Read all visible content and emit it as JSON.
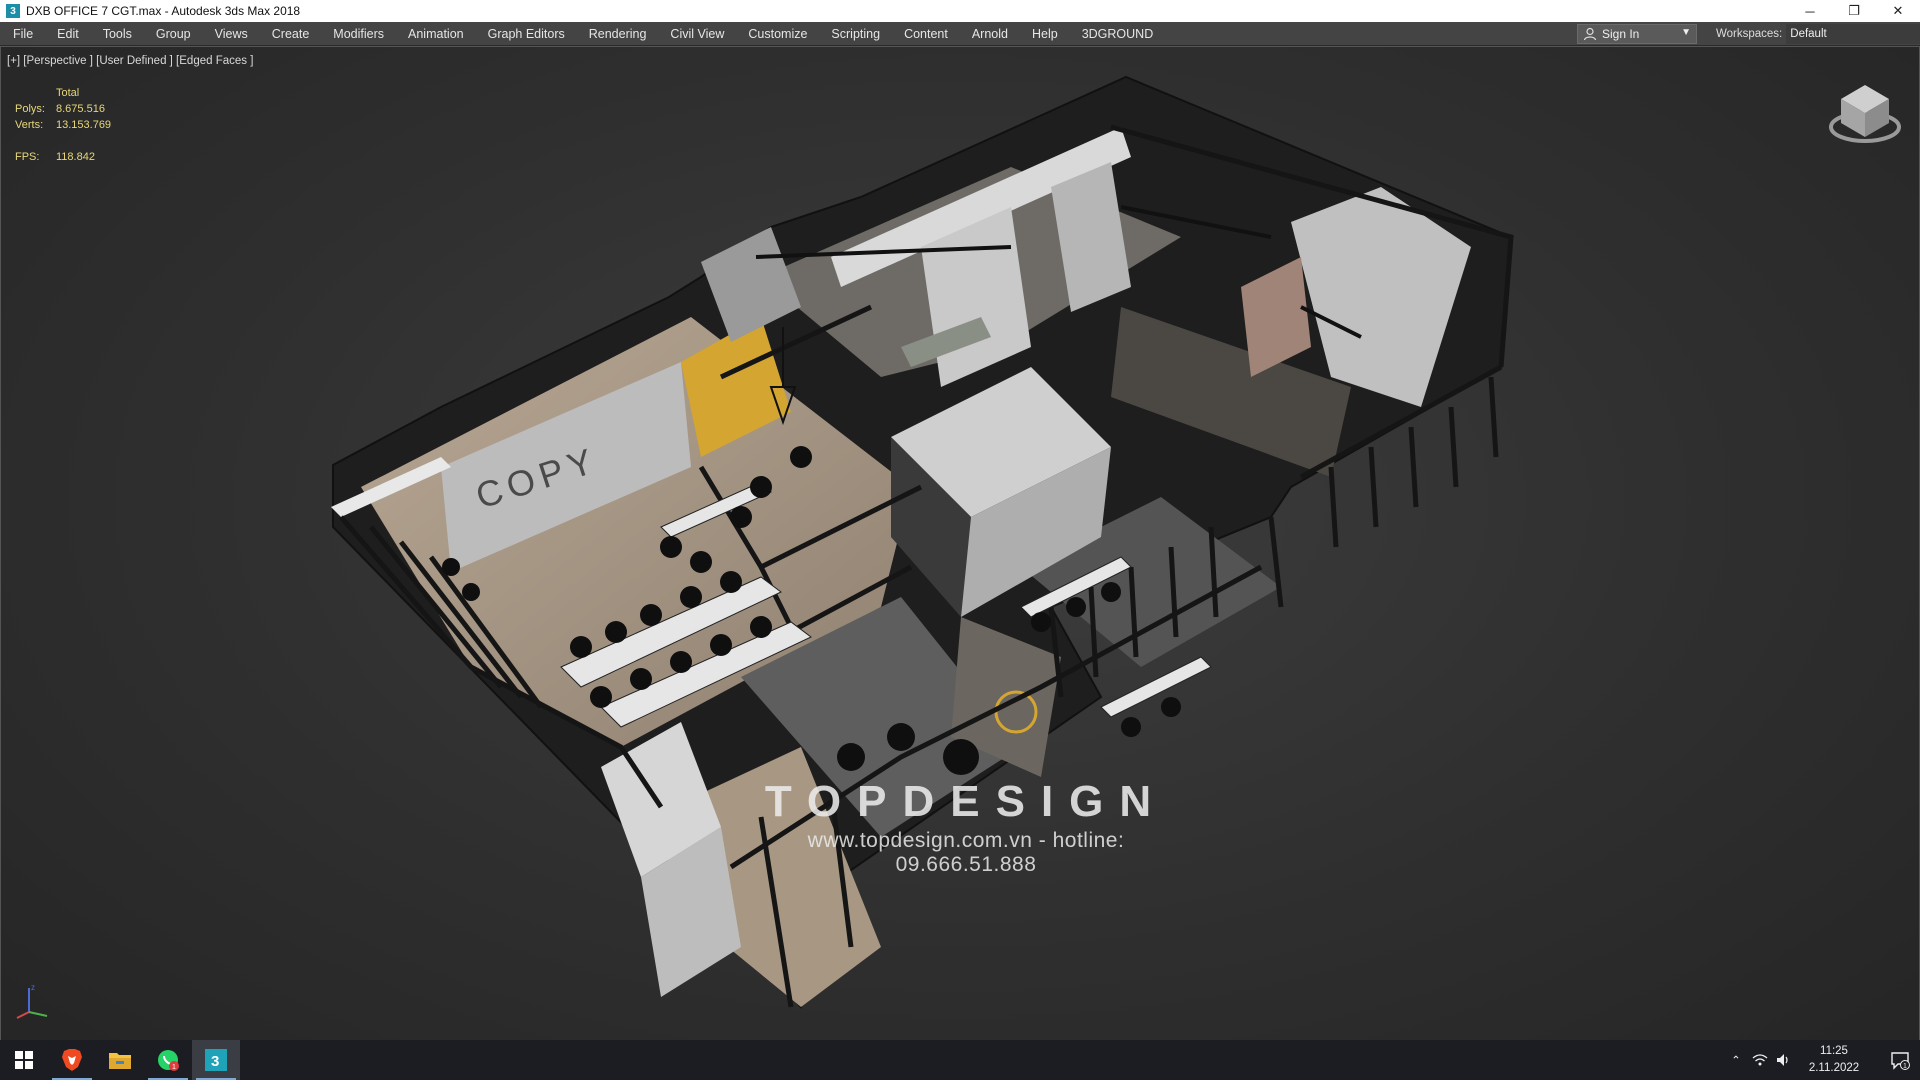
{
  "window": {
    "title": "DXB OFFICE 7 CGT.max - Autodesk 3ds Max 2018",
    "controls": {
      "minimize": "─",
      "restore": "❐",
      "close": "✕"
    }
  },
  "menu": {
    "items": [
      "File",
      "Edit",
      "Tools",
      "Group",
      "Views",
      "Create",
      "Modifiers",
      "Animation",
      "Graph Editors",
      "Rendering",
      "Civil View",
      "Customize",
      "Scripting",
      "Content",
      "Arnold",
      "Help",
      "3DGROUND"
    ],
    "sign_in": "Sign In",
    "workspaces_label": "Workspaces:",
    "workspace_value": "Default"
  },
  "viewport": {
    "label": "[+] [Perspective ] [User Defined ] [Edged Faces ]",
    "stats": {
      "header": "Total",
      "polys_label": "Polys:",
      "polys": "8.675.516",
      "verts_label": "Verts:",
      "verts": "13.153.769",
      "fps_label": "FPS:",
      "fps": "118.842"
    },
    "wall_text": "COPY",
    "watermark": {
      "brand": "TOPDESIGN",
      "contact": "www.topdesign.com.vn  -  hotline: 09.666.51.888"
    }
  },
  "taskbar": {
    "apps": [
      "windows-start",
      "brave-browser",
      "file-explorer",
      "whatsapp",
      "3ds-max"
    ],
    "whatsapp_badge": "1",
    "time": "11:25",
    "date": "2.11.2022",
    "notifications": "1"
  },
  "colors": {
    "menubar": "#444444",
    "viewport": "#2f2f2f",
    "stats_text": "#e8d77a",
    "accent_yellow": "#d4a531",
    "floor": "#a89886"
  }
}
